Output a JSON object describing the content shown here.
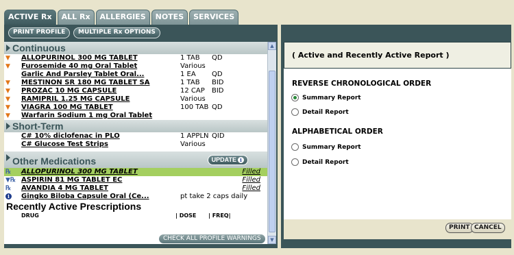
{
  "tabs": [
    "ACTIVE Rx",
    "ALL Rx",
    "ALLERGIES",
    "NOTES",
    "SERVICES"
  ],
  "toolbar": {
    "print_profile": "PRINT PROFILE",
    "multiple_rx": "MULTIPLE Rx OPTIONS"
  },
  "sections": {
    "continuous": "Continuous",
    "short_term": "Short-Term",
    "other": "Other Medications",
    "recent": "Recently Active Prescriptions"
  },
  "continuous": [
    {
      "marker": "▼",
      "name": "ALLOPURINOL 300 MG TABLET",
      "dose": "1 TAB",
      "freq": "QD"
    },
    {
      "marker": "▼",
      "name": "Furosemide 40 mg Oral Tablet",
      "dose": "Various",
      "freq": ""
    },
    {
      "marker": "",
      "name": "Garlic And Parsley Tablet Oral...",
      "dose": "1 EA",
      "freq": "QD"
    },
    {
      "marker": "▼",
      "name": "MESTINON SR 180 MG TABLET SA",
      "dose": "1 TAB",
      "freq": "BID"
    },
    {
      "marker": "▼",
      "name": "PROZAC 10 MG CAPSULE",
      "dose": "12 CAP",
      "freq": "BID"
    },
    {
      "marker": "▼",
      "name": "RAMIPRIL 1.25 MG CAPSULE",
      "dose": "Various",
      "freq": ""
    },
    {
      "marker": "▼",
      "name": "VIAGRA 100 MG TABLET",
      "dose": "100 TAB",
      "freq": "QD"
    },
    {
      "marker": "▼",
      "name": "Warfarin Sodium 1 mg Oral Tablet",
      "dose": "",
      "freq": ""
    }
  ],
  "short_term": [
    {
      "name": "C# 10% diclofenac in PLO",
      "dose": "1 APPLN",
      "freq": "QID"
    },
    {
      "name": "C# Glucose Test Strips",
      "dose": "Various",
      "freq": ""
    }
  ],
  "update_label": "UPDATE",
  "other": [
    {
      "marker": "℞",
      "name": "ALLOPURINOL 300 MG TABLET",
      "status": "Filled"
    },
    {
      "marker": "▼℞",
      "name": "ASPIRIN 81 MG TABLET EC",
      "status": "Filled"
    },
    {
      "marker": "℞",
      "name": "AVANDIA 4 MG TABLET",
      "status": "Filled"
    },
    {
      "marker": "i",
      "name": "Gingko Biloba Capsule Oral (Ce...",
      "dose": "pt take 2 caps daily"
    }
  ],
  "columns": {
    "drug": "DRUG",
    "dose": "| DOSE",
    "freq": "| FREQ|"
  },
  "check_warnings": "CHECK ALL PROFILE WARNINGS",
  "report": {
    "title": "( Active and Recently Active Report )",
    "sections": [
      {
        "heading": "REVERSE CHRONOLOGICAL ORDER",
        "options": [
          "Summary Report",
          "Detail Report"
        ]
      },
      {
        "heading": "ALPHABETICAL ORDER",
        "options": [
          "Summary Report",
          "Detail Report"
        ]
      }
    ],
    "selected": "REVERSE CHRONOLOGICAL ORDER / Summary Report",
    "print": "PRINT",
    "cancel": "CANCEL"
  },
  "colors": {
    "panel": "#3b5559",
    "highlight": "#a4cf5f",
    "warning": "#e27617",
    "background": "#e8e4cc"
  }
}
